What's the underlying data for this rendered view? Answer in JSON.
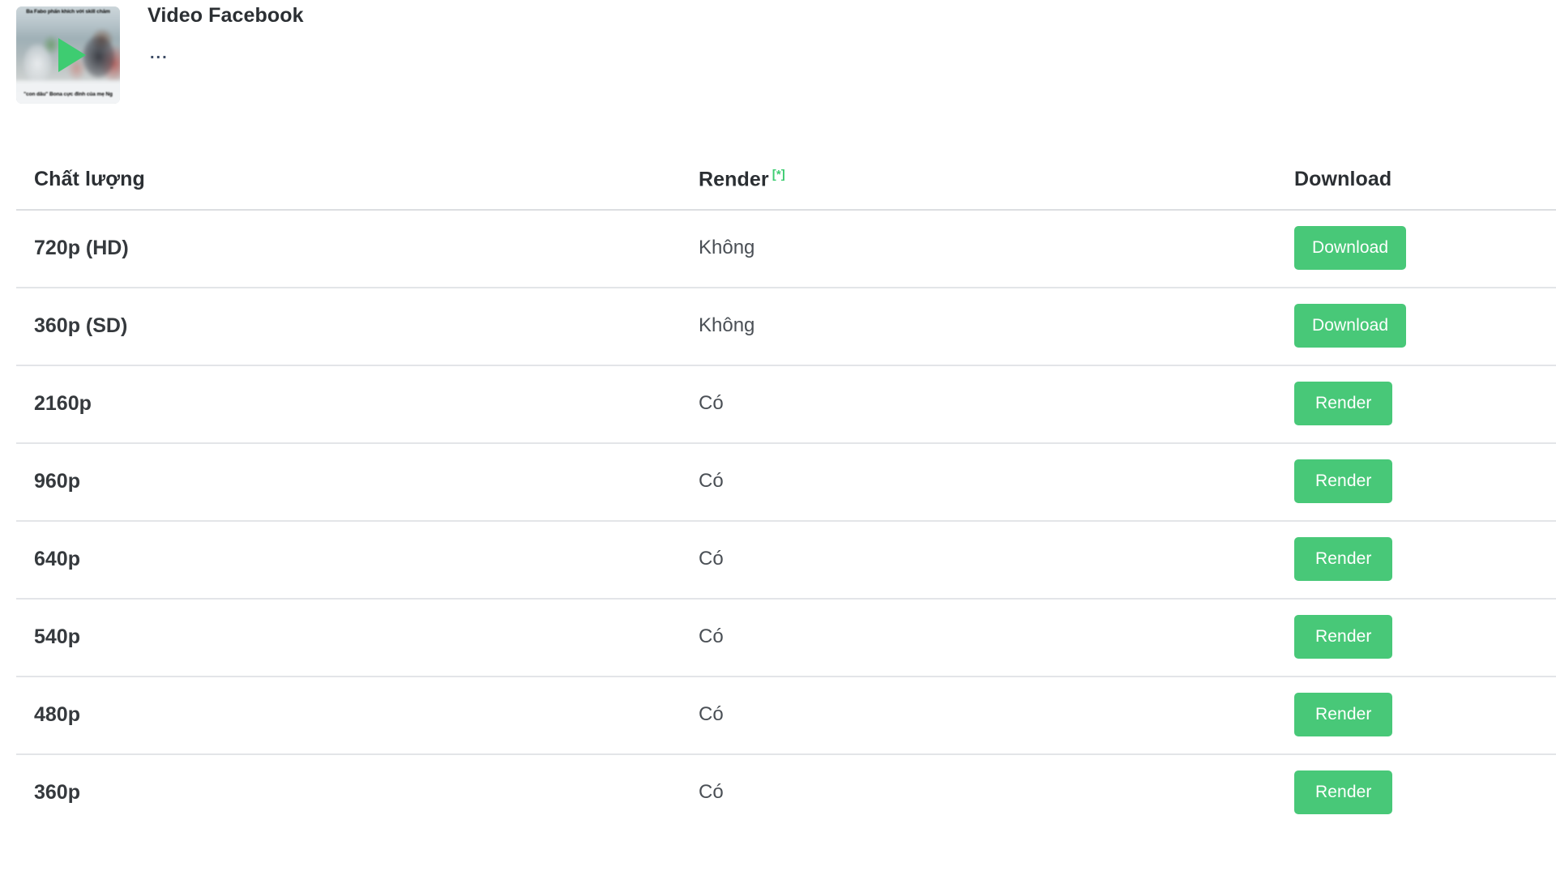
{
  "video": {
    "title": "Video Facebook",
    "description": "...",
    "thumbnail": {
      "caption_top": "Ba Fabo phấn khích với skill chăm",
      "caption_bottom": "\"con dâu\" Bona cực đỉnh của mẹ Ng",
      "play_icon": "play-icon"
    }
  },
  "table": {
    "headers": {
      "quality": "Chất lượng",
      "render": "Render",
      "render_superscript": "[*]",
      "download": "Download"
    },
    "rows": [
      {
        "quality": "720p (HD)",
        "render": "Không",
        "action": "Download",
        "action_type": "download"
      },
      {
        "quality": "360p (SD)",
        "render": "Không",
        "action": "Download",
        "action_type": "download"
      },
      {
        "quality": "2160p",
        "render": "Có",
        "action": "Render",
        "action_type": "render"
      },
      {
        "quality": "960p",
        "render": "Có",
        "action": "Render",
        "action_type": "render"
      },
      {
        "quality": "640p",
        "render": "Có",
        "action": "Render",
        "action_type": "render"
      },
      {
        "quality": "540p",
        "render": "Có",
        "action": "Render",
        "action_type": "render"
      },
      {
        "quality": "480p",
        "render": "Có",
        "action": "Render",
        "action_type": "render"
      },
      {
        "quality": "360p",
        "render": "Có",
        "action": "Render",
        "action_type": "render"
      }
    ]
  },
  "colors": {
    "accent_green": "#48c878",
    "play_green": "#3ecc71",
    "text_dark": "#2b2f33",
    "text_body": "#4a4f55",
    "divider": "#e3e5e8",
    "button_text": "#ffffff"
  }
}
